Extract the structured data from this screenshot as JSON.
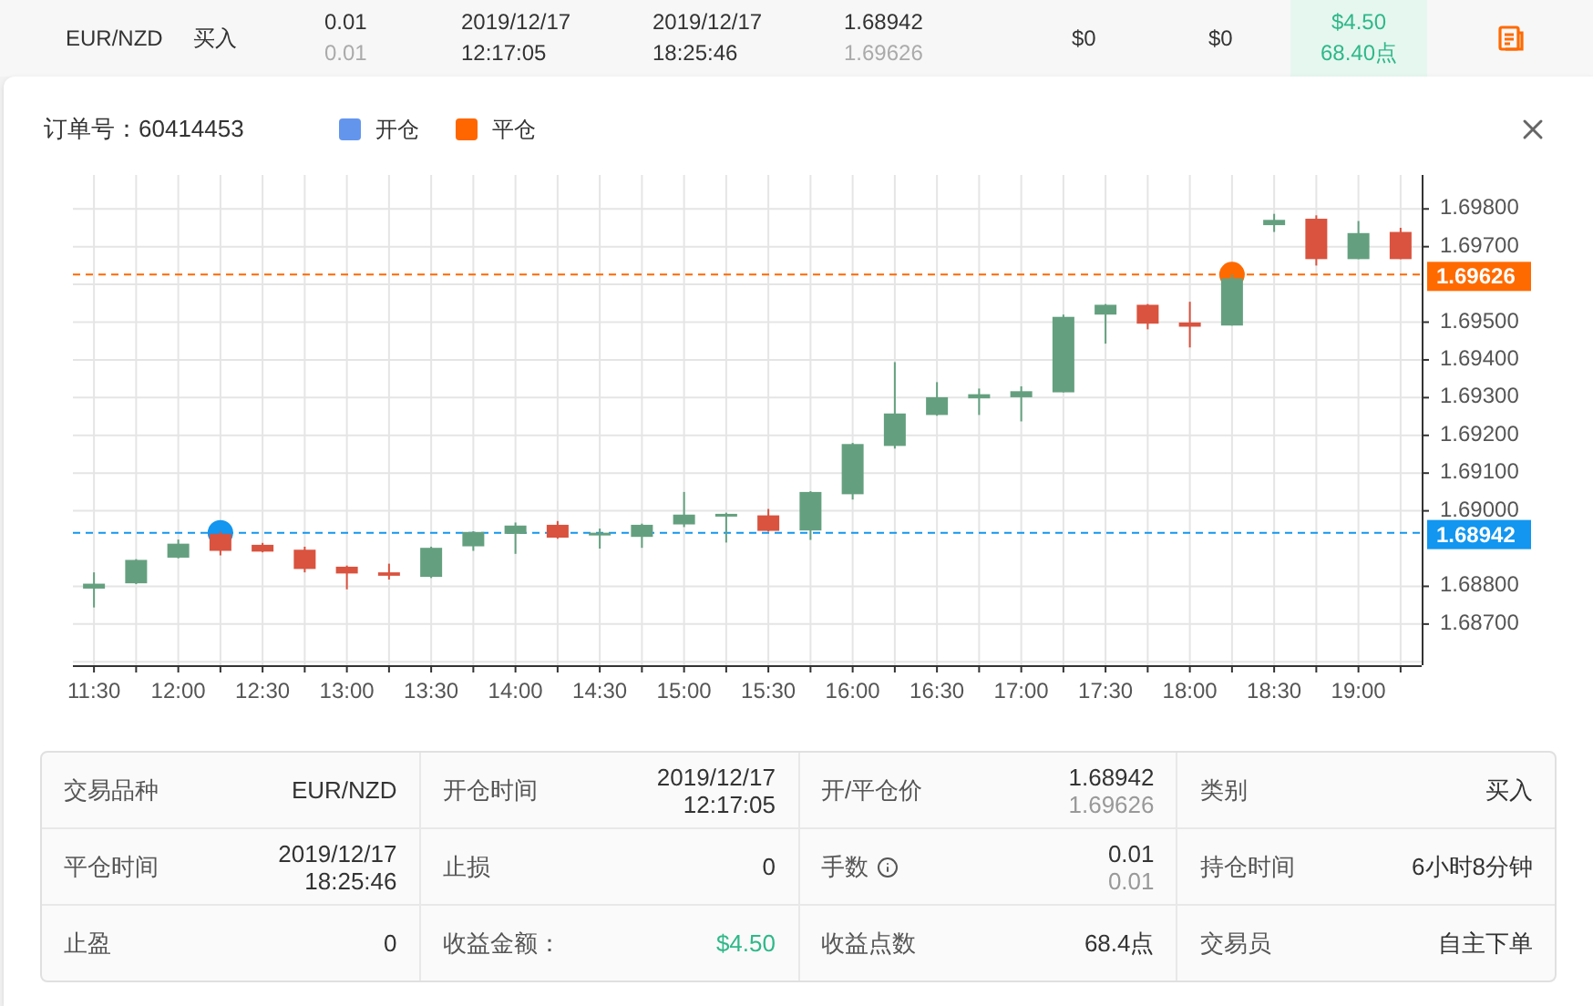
{
  "order_row": {
    "cells": [
      {
        "kind": "single",
        "primary": "EUR/NZD"
      },
      {
        "kind": "single",
        "primary": "买入"
      },
      {
        "kind": "pair",
        "primary": "0.01",
        "secondary": "0.01"
      },
      {
        "kind": "stacked",
        "primary": "2019/12/17",
        "secondary": "12:17:05"
      },
      {
        "kind": "stacked",
        "primary": "2019/12/17",
        "secondary": "18:25:46"
      },
      {
        "kind": "pair",
        "primary": "1.68942",
        "secondary": "1.69626"
      },
      {
        "kind": "single",
        "primary": "$0"
      },
      {
        "kind": "single",
        "primary": "$0"
      },
      {
        "kind": "profit",
        "primary": "$4.50",
        "secondary": "68.40点"
      }
    ]
  },
  "detail": {
    "order_number": "订单号：60414453",
    "legend": [
      {
        "label": "开仓",
        "color": "#6495ed"
      },
      {
        "label": "平仓",
        "color": "#ff6600"
      }
    ],
    "chart": {
      "chart_data": {
        "type": "candlestick",
        "grid": true,
        "x": [
          11.5,
          11.75,
          12,
          12.25,
          12.5,
          12.75,
          13,
          13.25,
          13.5,
          13.75,
          14,
          14.25,
          14.5,
          14.75,
          15,
          15.25,
          15.5,
          15.75,
          16,
          16.25,
          16.5,
          16.75,
          17,
          17.25,
          17.5,
          17.75,
          18,
          18.25,
          18.5,
          18.75,
          19,
          19.25
        ],
        "xlim": [
          11.375,
          19.375
        ],
        "ohlc": [
          [
            1.68794,
            1.68837,
            1.68744,
            1.68807
          ],
          [
            1.68808,
            1.68872,
            1.68806,
            1.6887
          ],
          [
            1.68876,
            1.68924,
            1.68874,
            1.68913
          ],
          [
            1.68939,
            1.68945,
            1.68882,
            1.68894
          ],
          [
            1.6891,
            1.68915,
            1.6889,
            1.68892
          ],
          [
            1.68897,
            1.68905,
            1.68837,
            1.68846
          ],
          [
            1.68852,
            1.68855,
            1.68792,
            1.68834
          ],
          [
            1.68837,
            1.6886,
            1.68818,
            1.68828
          ],
          [
            1.68825,
            1.68905,
            1.68822,
            1.68902
          ],
          [
            1.68906,
            1.68946,
            1.68894,
            1.68944
          ],
          [
            1.68939,
            1.68969,
            1.68886,
            1.68961
          ],
          [
            1.68963,
            1.68973,
            1.68926,
            1.68929
          ],
          [
            1.68939,
            1.68953,
            1.689,
            1.68942
          ],
          [
            1.68931,
            1.68966,
            1.68902,
            1.68963
          ],
          [
            1.68964,
            1.6905,
            1.68957,
            1.6899
          ],
          [
            1.68989,
            1.68995,
            1.68916,
            1.68992
          ],
          [
            1.68988,
            1.69005,
            1.68945,
            1.68947
          ],
          [
            1.68948,
            1.69052,
            1.68923,
            1.6905
          ],
          [
            1.69044,
            1.6918,
            1.6903,
            1.69177
          ],
          [
            1.69172,
            1.69394,
            1.69165,
            1.69258
          ],
          [
            1.69254,
            1.69341,
            1.69252,
            1.69301
          ],
          [
            1.69298,
            1.69324,
            1.69254,
            1.69309
          ],
          [
            1.69301,
            1.6933,
            1.69237,
            1.69317
          ],
          [
            1.69314,
            1.6952,
            1.69314,
            1.69514
          ],
          [
            1.6952,
            1.69548,
            1.69443,
            1.69546
          ],
          [
            1.69546,
            1.69548,
            1.69481,
            1.69496
          ],
          [
            1.69499,
            1.69554,
            1.69433,
            1.69488
          ],
          [
            1.69491,
            1.69626,
            1.69491,
            1.69616
          ],
          [
            1.69757,
            1.69787,
            1.69739,
            1.69771
          ],
          [
            1.69774,
            1.69783,
            1.6965,
            1.69667
          ],
          [
            1.69667,
            1.69768,
            1.69667,
            1.69736
          ],
          [
            1.69739,
            1.6975,
            1.69667,
            1.69667
          ]
        ],
        "ylim": [
          1.68591,
          1.6989
        ],
        "xticks": [
          {
            "value": 11.5,
            "label": "11:30"
          },
          {
            "value": 12,
            "label": "12:00"
          },
          {
            "value": 12.5,
            "label": "12:30"
          },
          {
            "value": 13,
            "label": "13:00"
          },
          {
            "value": 13.5,
            "label": "13:30"
          },
          {
            "value": 14,
            "label": "14:00"
          },
          {
            "value": 14.5,
            "label": "14:30"
          },
          {
            "value": 15,
            "label": "15:00"
          },
          {
            "value": 15.5,
            "label": "15:30"
          },
          {
            "value": 16,
            "label": "16:00"
          },
          {
            "value": 16.5,
            "label": "16:30"
          },
          {
            "value": 17,
            "label": "17:00"
          },
          {
            "value": 17.5,
            "label": "17:30"
          },
          {
            "value": 18,
            "label": "18:00"
          },
          {
            "value": 18.5,
            "label": "18:30"
          },
          {
            "value": 19,
            "label": "19:00"
          }
        ],
        "yticks": [
          {
            "value": 1.687,
            "label": "1.68700"
          },
          {
            "value": 1.688,
            "label": "1.68800"
          },
          {
            "value": 1.69,
            "label": "1.69000"
          },
          {
            "value": 1.691,
            "label": "1.69100"
          },
          {
            "value": 1.692,
            "label": "1.69200"
          },
          {
            "value": 1.693,
            "label": "1.69300"
          },
          {
            "value": 1.694,
            "label": "1.69400"
          },
          {
            "value": 1.695,
            "label": "1.69500"
          },
          {
            "value": 1.697,
            "label": "1.69700"
          },
          {
            "value": 1.698,
            "label": "1.69800"
          }
        ],
        "ref_lines": [
          {
            "axis": "y",
            "value": 1.68942,
            "label": "1.68942",
            "color": "#1296f0"
          },
          {
            "axis": "y",
            "value": 1.69626,
            "label": "1.69626",
            "color": "#ff6a00"
          }
        ]
      }
    },
    "details": [
      [
        {
          "label": "交易品种",
          "kind": "plain",
          "value": "EUR/NZD"
        },
        {
          "label": "开仓时间",
          "kind": "stacked",
          "value": "2019/12/17",
          "value2": "12:17:05"
        },
        {
          "label": "开/平仓价",
          "kind": "pair",
          "value": "1.68942",
          "value2": "1.69626"
        },
        {
          "label": "类别",
          "kind": "plain",
          "value": "买入"
        }
      ],
      [
        {
          "label": "平仓时间",
          "kind": "stacked",
          "value": "2019/12/17",
          "value2": "18:25:46"
        },
        {
          "label": "止损",
          "kind": "plain",
          "value": "0"
        },
        {
          "label": "手数",
          "info": true,
          "kind": "pair",
          "value": "0.01",
          "value2": "0.01"
        },
        {
          "label": "持仓时间",
          "kind": "plain",
          "value": "6小时8分钟"
        }
      ],
      [
        {
          "label": "止盈",
          "kind": "plain",
          "value": "0"
        },
        {
          "label": "收益金额：",
          "kind": "profit",
          "value": "$4.50"
        },
        {
          "label": "收益点数",
          "kind": "plain",
          "value": "68.4点"
        },
        {
          "label": "交易员",
          "kind": "plain",
          "value": "自主下单"
        }
      ]
    ]
  }
}
